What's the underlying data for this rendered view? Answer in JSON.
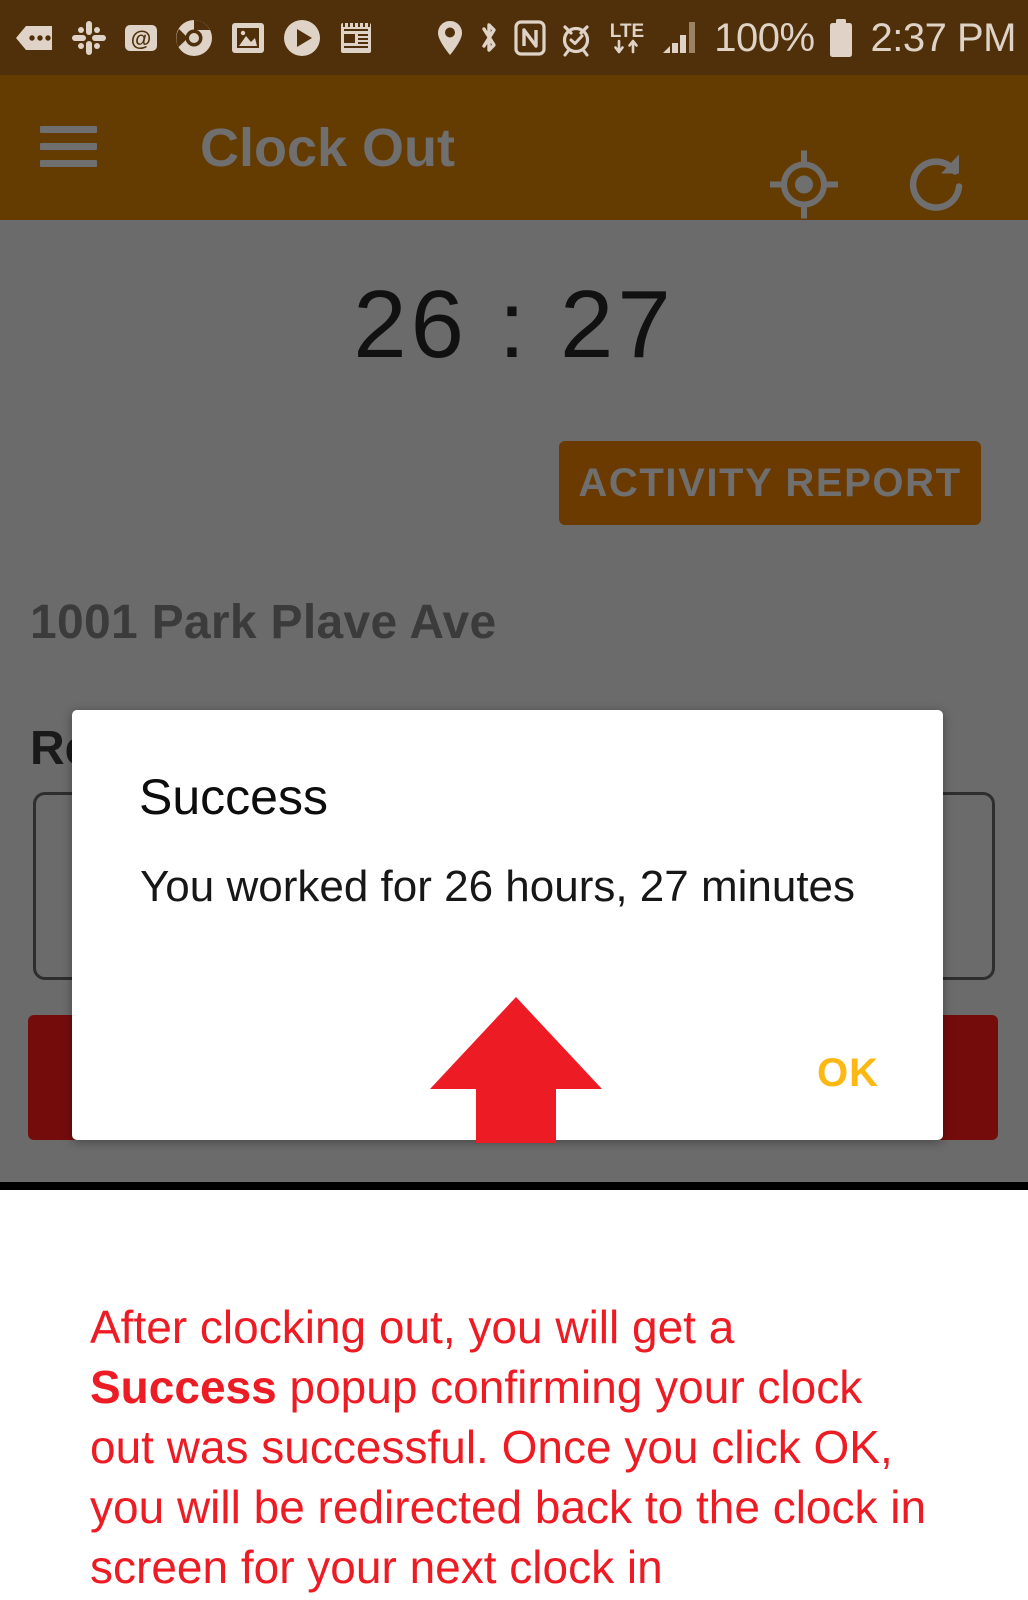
{
  "status_bar": {
    "notification_icons": [
      "message-bubble-icon",
      "slack-icon",
      "email-at-icon",
      "chrome-icon",
      "gallery-photo-icon",
      "play-media-icon",
      "news-document-icon"
    ],
    "system_icons": [
      "location-pin-icon",
      "bluetooth-icon",
      "nfc-icon",
      "alarm-clock-icon",
      "lte-data-icon",
      "signal-bars-icon"
    ],
    "battery_percent": "100%",
    "battery_icon": "battery-full-icon",
    "time": "2:37 PM"
  },
  "app_bar": {
    "menu_icon": "hamburger-menu-icon",
    "title": "Clock Out",
    "gps_icon": "gps-crosshair-icon",
    "refresh_icon": "refresh-icon"
  },
  "screen": {
    "timer": "26 : 27",
    "activity_report_label": "ACTIVITY REPORT",
    "address": "1001 Park Plave Ave",
    "reason_label": "Re",
    "reason_value": "",
    "clock_out_label": ""
  },
  "dialog": {
    "title": "Success",
    "message": "You worked for 26 hours, 27 minutes",
    "ok_label": "OK"
  },
  "annotation": {
    "arrow_icon": "up-arrow-annotation-icon",
    "arrow_color": "#ed1c24",
    "caption_part1": "After clocking out, you will get a ",
    "caption_bold": "Success",
    "caption_part2": " popup confirming your clock out was successful. Once you click OK, you will be redirected back to the clock in screen for your next clock in"
  },
  "colors": {
    "status_bar_bg": "#50300a",
    "app_bar_bg": "#643b00",
    "scrim": "#6b6b6b",
    "activity_button": "#6b3a00",
    "clock_out_button": "#750c0c",
    "ok_accent": "#fdb813",
    "annotation_red": "#ed1c24"
  }
}
